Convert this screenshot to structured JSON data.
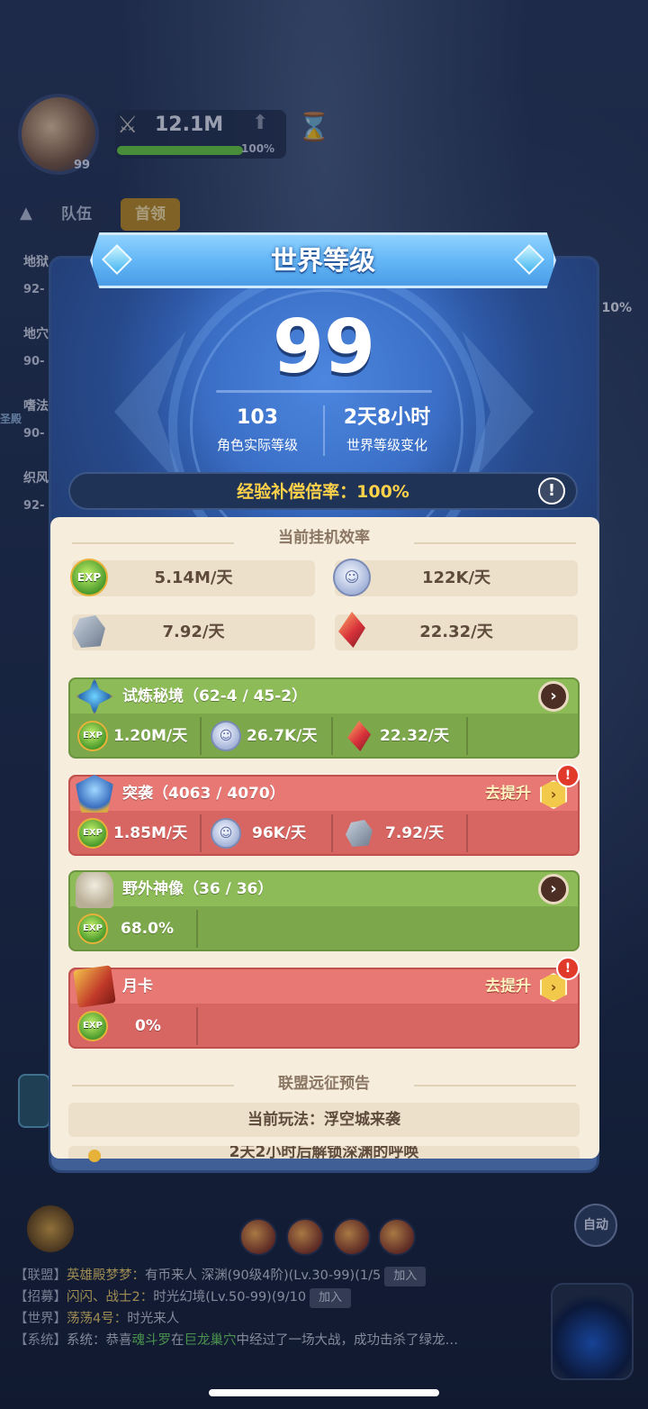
{
  "hud": {
    "hero_level": "99",
    "power": "12.1M",
    "power_pct": "100%",
    "power_fill": 1.0,
    "tabs": [
      "队伍",
      "首领"
    ],
    "side_labels": [
      "地狱",
      "地穴",
      "嗜法",
      "织风"
    ],
    "side_levels": [
      "92-",
      "90-",
      "90-",
      "92-"
    ],
    "side_extra": "圣殿",
    "right_pct": "10%"
  },
  "dialog": {
    "title": "世界等级",
    "world_level": "99",
    "actual_level": "103",
    "actual_level_label": "角色实际等级",
    "change_time": "2天8小时",
    "change_label": "世界等级变化",
    "exp_rate": "经验补偿倍率：100%",
    "info_icon": "!"
  },
  "efficiency": {
    "title": "当前挂机效率",
    "exp": "5.14M/天",
    "coin": "122K/天",
    "ore": "7.92/天",
    "crystal": "22.32/天",
    "exp_icon_label": "EXP"
  },
  "cards": [
    {
      "title": "试炼秘境（62-4 / 45-2）",
      "color": "green",
      "rewards": [
        "1.20M/天",
        "26.7K/天",
        "22.32/天"
      ]
    },
    {
      "title": "突袭（4063 / 4070）",
      "color": "red",
      "action": "去提升",
      "rewards": [
        "1.85M/天",
        "96K/天",
        "7.92/天"
      ]
    },
    {
      "title": "野外神像（36 / 36）",
      "color": "green",
      "rewards": [
        "68.0%"
      ]
    },
    {
      "title": "月卡",
      "color": "red",
      "action": "去提升",
      "rewards": [
        "0%"
      ]
    }
  ],
  "alliance": {
    "title": "联盟远征预告",
    "current": "当前玩法：浮空城来袭",
    "next": "2天2小时后解锁深渊的呼唤"
  },
  "bottom": {
    "auto": "自动"
  },
  "chat": [
    {
      "channel": "【联盟】",
      "name": "英雄殿梦梦：",
      "text": "有币来人 深渊(90级4阶)(Lv.30-99)(1/5",
      "button": "加入"
    },
    {
      "channel": "【招募】",
      "name": "闪闪、战士2：",
      "text": "时光幻境(Lv.50-99)(9/10",
      "button": "加入"
    },
    {
      "channel": "【世界】",
      "name": "荡荡4号：",
      "text": "时光来人",
      "button": ""
    },
    {
      "channel": "【系统】",
      "name": "系统：",
      "pre": "恭喜",
      "player": "魂斗罗",
      "mid": "在",
      "place": "巨龙巢穴",
      "post": "中经过了一场大战，成功击杀了绿龙…"
    }
  ],
  "colors": {
    "accent_gold": "#ffd24a",
    "card_green": "#7ca74a",
    "card_red": "#d76562",
    "parchment": "#f6eddc"
  },
  "icons": {
    "exp": "exp-icon",
    "coin": "silver-coin-icon",
    "ore": "ore-icon",
    "crystal": "red-crystal-icon"
  }
}
